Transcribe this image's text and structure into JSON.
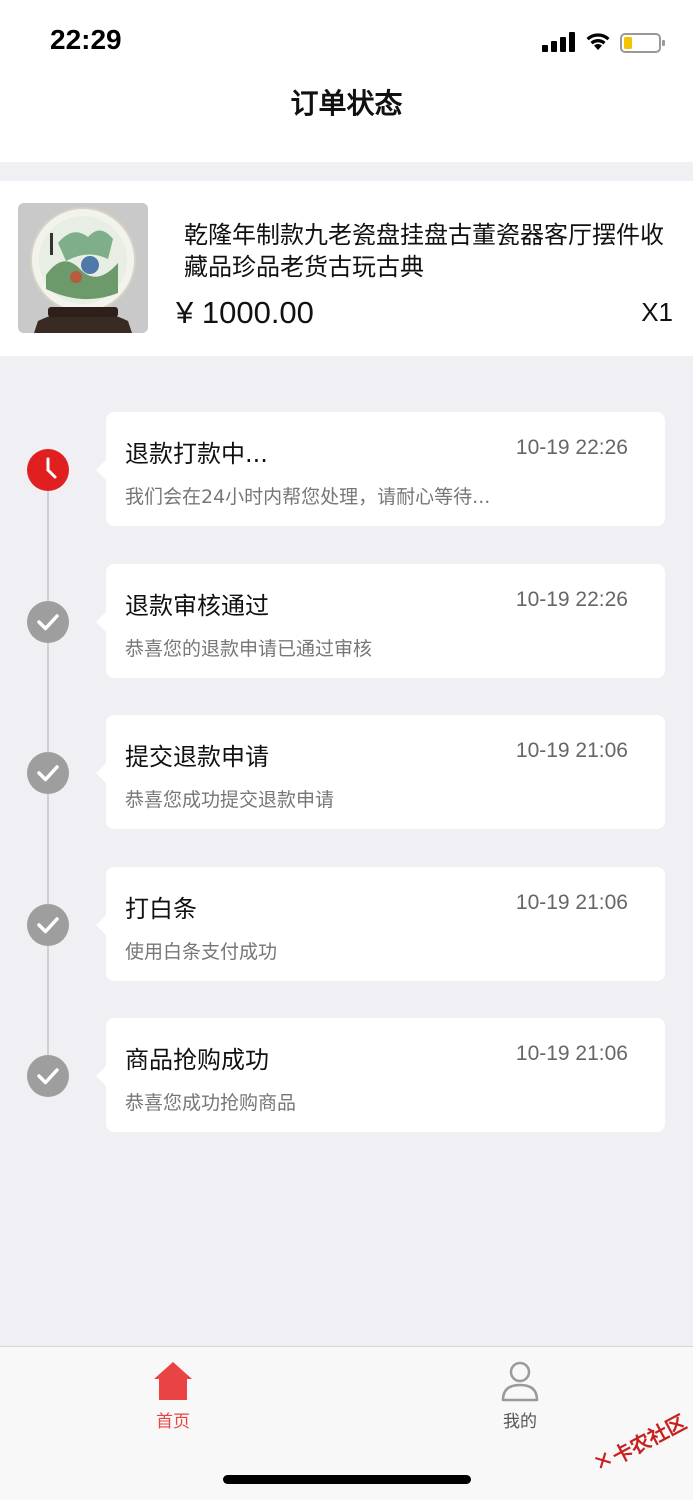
{
  "status_bar": {
    "time": "22:29"
  },
  "nav": {
    "title": "订单状态"
  },
  "product": {
    "name": "乾隆年制款九老瓷盘挂盘古董瓷器客厅摆件收藏品珍品老货古玩古典",
    "price": "¥ 1000.00",
    "quantity": "X1"
  },
  "timeline": [
    {
      "title": "退款打款中...",
      "time": "10-19 22:26",
      "desc": "我们会在24小时内帮您处理，请耐心等待...",
      "icon": "clock-icon",
      "active": true
    },
    {
      "title": "退款审核通过",
      "time": "10-19 22:26",
      "desc": "恭喜您的退款申请已通过审核",
      "icon": "check-icon",
      "active": false
    },
    {
      "title": "提交退款申请",
      "time": "10-19 21:06",
      "desc": "恭喜您成功提交退款申请",
      "icon": "check-icon",
      "active": false
    },
    {
      "title": "打白条",
      "time": "10-19 21:06",
      "desc": "使用白条支付成功",
      "icon": "check-icon",
      "active": false
    },
    {
      "title": "商品抢购成功",
      "time": "10-19 21:06",
      "desc": "恭喜您成功抢购商品",
      "icon": "check-icon",
      "active": false
    }
  ],
  "tabs": {
    "home_label": "首页",
    "mine_label": "我的"
  },
  "watermark": {
    "text": "卡农社区"
  },
  "colors": {
    "accent": "#e02020",
    "tab_active": "#e94343",
    "inactive_dot": "#9e9e9e",
    "background": "#efeff4"
  }
}
